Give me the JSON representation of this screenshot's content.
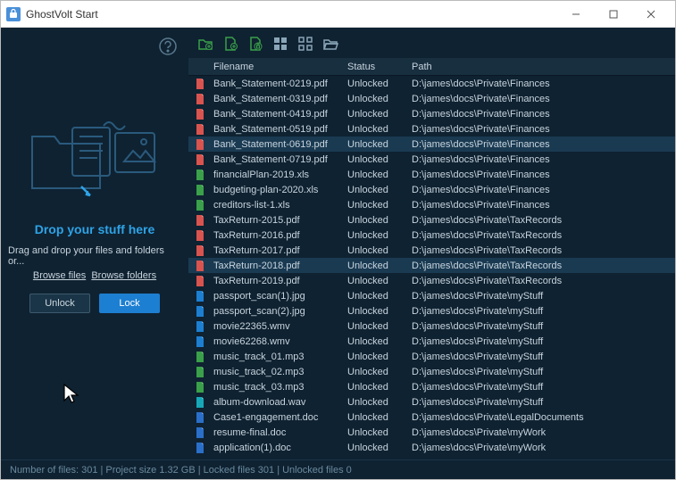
{
  "app_title": "GhostVolt Start",
  "drop_zone": {
    "title": "Drop your stuff here",
    "subtitle": "Drag and drop your files and folders or...",
    "browse_files": "Browse files",
    "browse_folders": "Browse folders",
    "unlock_label": "Unlock",
    "lock_label": "Lock"
  },
  "columns": {
    "name": "Filename",
    "status": "Status",
    "path": "Path"
  },
  "files": [
    {
      "name": "Bank_Statement-0219.pdf",
      "status": "Unlocked",
      "path": "D:\\james\\docs\\Private\\Finances",
      "type": "pdf",
      "sel": false
    },
    {
      "name": "Bank_Statement-0319.pdf",
      "status": "Unlocked",
      "path": "D:\\james\\docs\\Private\\Finances",
      "type": "pdf",
      "sel": false
    },
    {
      "name": "Bank_Statement-0419.pdf",
      "status": "Unlocked",
      "path": "D:\\james\\docs\\Private\\Finances",
      "type": "pdf",
      "sel": false
    },
    {
      "name": "Bank_Statement-0519.pdf",
      "status": "Unlocked",
      "path": "D:\\james\\docs\\Private\\Finances",
      "type": "pdf",
      "sel": false
    },
    {
      "name": "Bank_Statement-0619.pdf",
      "status": "Unlocked",
      "path": "D:\\james\\docs\\Private\\Finances",
      "type": "pdf",
      "sel": true
    },
    {
      "name": "Bank_Statement-0719.pdf",
      "status": "Unlocked",
      "path": "D:\\james\\docs\\Private\\Finances",
      "type": "pdf",
      "sel": false
    },
    {
      "name": "financialPlan-2019.xls",
      "status": "Unlocked",
      "path": "D:\\james\\docs\\Private\\Finances",
      "type": "xls",
      "sel": false
    },
    {
      "name": "budgeting-plan-2020.xls",
      "status": "Unlocked",
      "path": "D:\\james\\docs\\Private\\Finances",
      "type": "xls",
      "sel": false
    },
    {
      "name": "creditors-list-1.xls",
      "status": "Unlocked",
      "path": "D:\\james\\docs\\Private\\Finances",
      "type": "xls",
      "sel": false
    },
    {
      "name": "TaxReturn-2015.pdf",
      "status": "Unlocked",
      "path": "D:\\james\\docs\\Private\\TaxRecords",
      "type": "pdf",
      "sel": false
    },
    {
      "name": "TaxReturn-2016.pdf",
      "status": "Unlocked",
      "path": "D:\\james\\docs\\Private\\TaxRecords",
      "type": "pdf",
      "sel": false
    },
    {
      "name": "TaxReturn-2017.pdf",
      "status": "Unlocked",
      "path": "D:\\james\\docs\\Private\\TaxRecords",
      "type": "pdf",
      "sel": false
    },
    {
      "name": "TaxReturn-2018.pdf",
      "status": "Unlocked",
      "path": "D:\\james\\docs\\Private\\TaxRecords",
      "type": "pdf",
      "sel": true
    },
    {
      "name": "TaxReturn-2019.pdf",
      "status": "Unlocked",
      "path": "D:\\james\\docs\\Private\\TaxRecords",
      "type": "pdf",
      "sel": false
    },
    {
      "name": "passport_scan(1).jpg",
      "status": "Unlocked",
      "path": "D:\\james\\docs\\Private\\myStuff",
      "type": "jpg",
      "sel": false
    },
    {
      "name": "passport_scan(2).jpg",
      "status": "Unlocked",
      "path": "D:\\james\\docs\\Private\\myStuff",
      "type": "jpg",
      "sel": false
    },
    {
      "name": "movie22365.wmv",
      "status": "Unlocked",
      "path": "D:\\james\\docs\\Private\\myStuff",
      "type": "wmv",
      "sel": false
    },
    {
      "name": "movie62268.wmv",
      "status": "Unlocked",
      "path": "D:\\james\\docs\\Private\\myStuff",
      "type": "wmv",
      "sel": false
    },
    {
      "name": "music_track_01.mp3",
      "status": "Unlocked",
      "path": "D:\\james\\docs\\Private\\myStuff",
      "type": "mp3",
      "sel": false
    },
    {
      "name": "music_track_02.mp3",
      "status": "Unlocked",
      "path": "D:\\james\\docs\\Private\\myStuff",
      "type": "mp3",
      "sel": false
    },
    {
      "name": "music_track_03.mp3",
      "status": "Unlocked",
      "path": "D:\\james\\docs\\Private\\myStuff",
      "type": "mp3",
      "sel": false
    },
    {
      "name": "album-download.wav",
      "status": "Unlocked",
      "path": "D:\\james\\docs\\Private\\myStuff",
      "type": "wav",
      "sel": false
    },
    {
      "name": "Case1-engagement.doc",
      "status": "Unlocked",
      "path": "D:\\james\\docs\\Private\\LegalDocuments",
      "type": "doc",
      "sel": false
    },
    {
      "name": "resume-final.doc",
      "status": "Unlocked",
      "path": "D:\\james\\docs\\Private\\myWork",
      "type": "doc",
      "sel": false
    },
    {
      "name": "application(1).doc",
      "status": "Unlocked",
      "path": "D:\\james\\docs\\Private\\myWork",
      "type": "doc",
      "sel": false
    }
  ],
  "status_text": "Number of files: 301 | Project size 1.32 GB | Locked files 301 | Unlocked files 0"
}
